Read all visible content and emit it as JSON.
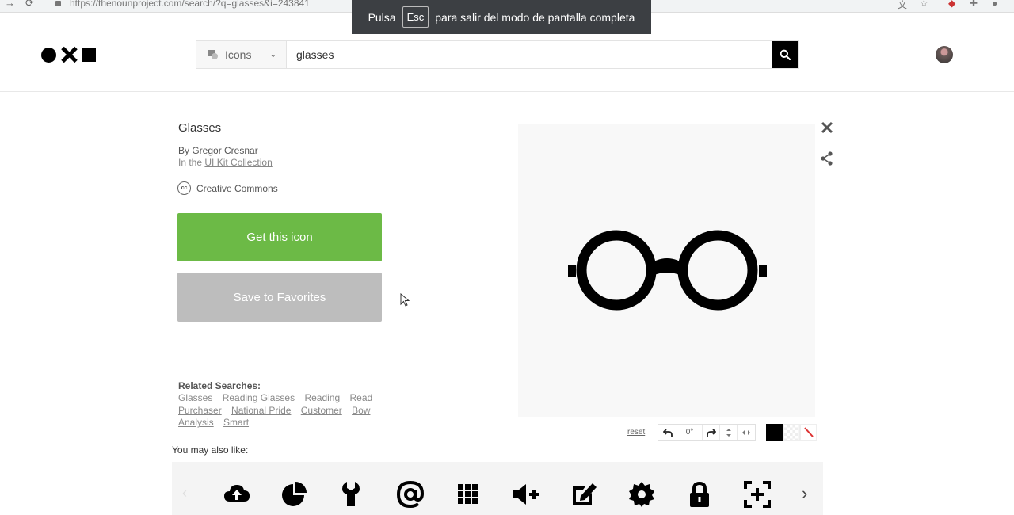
{
  "browser": {
    "url": "https://thenounproject.com/search/?q=glasses&i=243841"
  },
  "fullscreen_toast": {
    "before": "Pulsa",
    "key": "Esc",
    "after": "para salir del modo de pantalla completa"
  },
  "header": {
    "type_select": "Icons",
    "search_value": "glasses"
  },
  "icon_detail": {
    "title": "Glasses",
    "author": "By Gregor Cresnar",
    "collection_prefix": "In the",
    "collection_link": "UI Kit Collection",
    "license": "Creative Commons",
    "cc_glyph": "cc",
    "get_button": "Get this icon",
    "favorites_button": "Save to Favorites"
  },
  "related": {
    "label": "Related Searches:",
    "terms": [
      "Glasses",
      "Reading Glasses",
      "Reading",
      "Read",
      "Purchaser",
      "National Pride",
      "Customer",
      "Bow",
      "Analysis",
      "Smart"
    ]
  },
  "preview_controls": {
    "reset": "reset",
    "rotation": "0°"
  },
  "also_like": {
    "label": "You may also like:",
    "icons": [
      "cloud-upload-icon",
      "pie-chart-icon",
      "wrench-icon",
      "at-sign-icon",
      "grid-icon",
      "volume-up-icon",
      "edit-icon",
      "gear-icon",
      "lock-icon",
      "focus-add-icon"
    ]
  },
  "colors": {
    "accent_green": "#6cba46",
    "favorites_gray": "#bdbdbd",
    "toast_bg": "#3c3f43"
  }
}
